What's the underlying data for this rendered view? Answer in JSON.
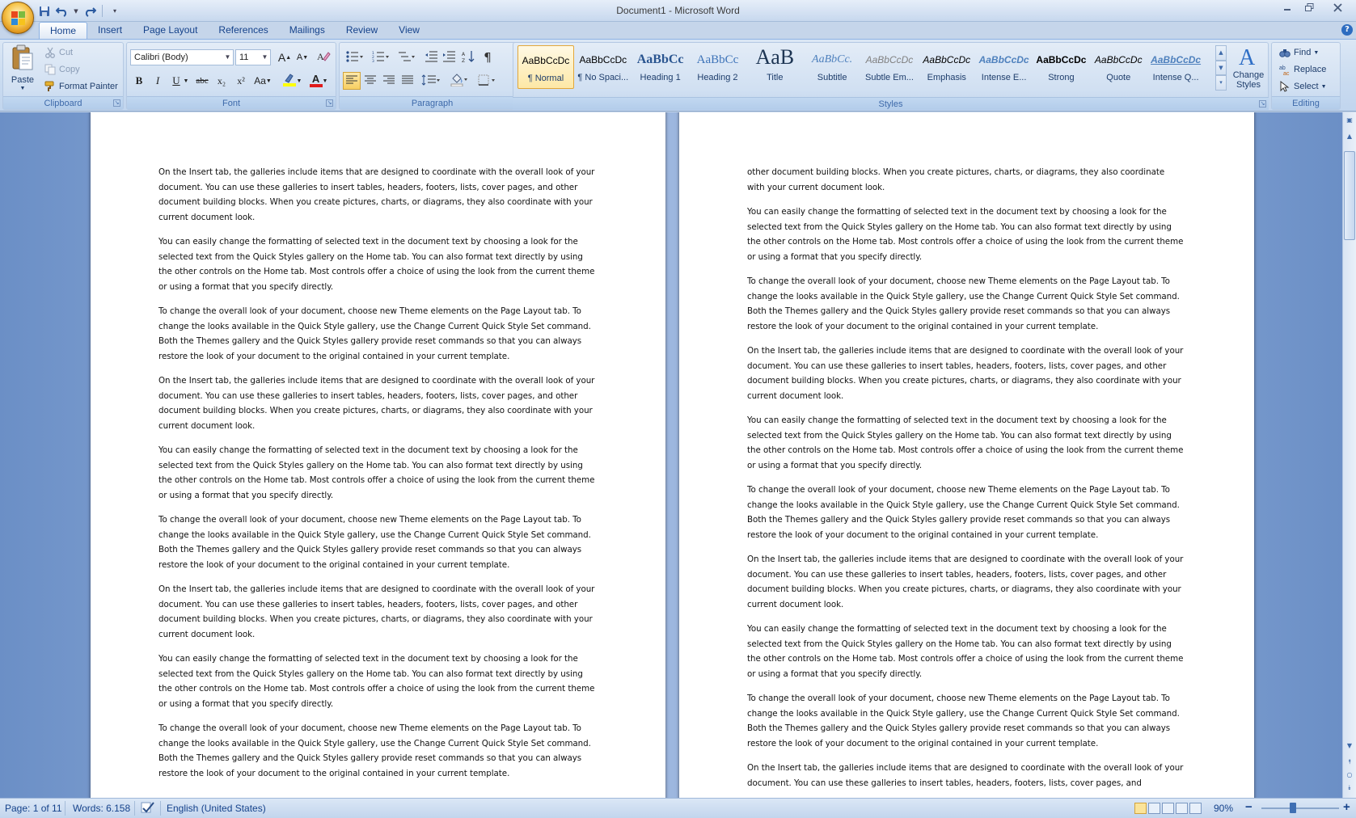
{
  "window": {
    "title": "Document1 - Microsoft Word",
    "controls": [
      "minimize",
      "restore",
      "close"
    ]
  },
  "quick_access": {
    "items": [
      {
        "name": "save-icon"
      },
      {
        "name": "undo-icon"
      },
      {
        "name": "redo-icon"
      },
      {
        "name": "customize-qat-icon"
      }
    ]
  },
  "tabs": [
    {
      "label": "Home",
      "active": true
    },
    {
      "label": "Insert"
    },
    {
      "label": "Page Layout"
    },
    {
      "label": "References"
    },
    {
      "label": "Mailings"
    },
    {
      "label": "Review"
    },
    {
      "label": "View"
    }
  ],
  "ribbon": {
    "clipboard": {
      "label": "Clipboard",
      "paste": "Paste",
      "cut": "Cut",
      "copy": "Copy",
      "format_painter": "Format Painter"
    },
    "font": {
      "label": "Font",
      "family": "Calibri (Body)",
      "size": "11",
      "grow": "A",
      "shrink": "A",
      "bold": "B",
      "italic": "I",
      "underline": "U",
      "strike": "abc",
      "subscript": "x₂",
      "superscript": "x²",
      "change_case": "Aa",
      "font_color_glyph": "A",
      "highlight_color": "#ffff00",
      "font_color": "#e01b1b"
    },
    "paragraph": {
      "label": "Paragraph"
    },
    "styles": {
      "label": "Styles",
      "items": [
        {
          "sample": "AaBbCcDc",
          "name": "¶ Normal",
          "selected": true
        },
        {
          "sample": "AaBbCcDc",
          "name": "¶ No Spaci..."
        },
        {
          "sample": "AaBbCc",
          "name": "Heading 1"
        },
        {
          "sample": "AaBbCc",
          "name": "Heading 2"
        },
        {
          "sample": "AaB",
          "name": "Title"
        },
        {
          "sample": "AaBbCc.",
          "name": "Subtitle"
        },
        {
          "sample": "AaBbCcDc",
          "name": "Subtle Em..."
        },
        {
          "sample": "AaBbCcDc",
          "name": "Emphasis"
        },
        {
          "sample": "AaBbCcDc",
          "name": "Intense E..."
        },
        {
          "sample": "AaBbCcDc",
          "name": "Strong"
        },
        {
          "sample": "AaBbCcDc",
          "name": "Quote"
        },
        {
          "sample": "AaBbCcDc",
          "name": "Intense Q..."
        }
      ],
      "change_styles_line1": "Change",
      "change_styles_line2": "Styles"
    },
    "editing": {
      "label": "Editing",
      "find": "Find",
      "replace": "Replace",
      "select": "Select"
    }
  },
  "document": {
    "left_page": [
      "On the Insert tab, the galleries include items that are designed to coordinate with the overall look of your document. You can use these galleries to insert tables, headers, footers, lists, cover pages, and other document building blocks. When you create pictures, charts, or diagrams, they also coordinate with your current document look.",
      "You can easily change the formatting of selected text in the document text by choosing a look for the selected text from the Quick Styles gallery on the Home tab. You can also format text directly by using the other controls on the Home tab. Most controls offer a choice of using the look from the current theme or using a format that you specify directly.",
      "To change the overall look of your document, choose new Theme elements on the Page Layout tab. To change the looks available in the Quick Style gallery, use the Change Current Quick Style Set command. Both the Themes gallery and the Quick Styles gallery provide reset commands so that you can always restore the look of your document to the original contained in your current template.",
      "On the Insert tab, the galleries include items that are designed to coordinate with the overall look of your document. You can use these galleries to insert tables, headers, footers, lists, cover pages, and other document building blocks. When you create pictures, charts, or diagrams, they also coordinate with your current document look.",
      "You can easily change the formatting of selected text in the document text by choosing a look for the selected text from the Quick Styles gallery on the Home tab. You can also format text directly by using the other controls on the Home tab. Most controls offer a choice of using the look from the current theme or using a format that you specify directly.",
      "To change the overall look of your document, choose new Theme elements on the Page Layout tab. To change the looks available in the Quick Style gallery, use the Change Current Quick Style Set command. Both the Themes gallery and the Quick Styles gallery provide reset commands so that you can always restore the look of your document to the original contained in your current template.",
      "On the Insert tab, the galleries include items that are designed to coordinate with the overall look of your document. You can use these galleries to insert tables, headers, footers, lists, cover pages, and other document building blocks. When you create pictures, charts, or diagrams, they also coordinate with your current document look.",
      "You can easily change the formatting of selected text in the document text by choosing a look for the selected text from the Quick Styles gallery on the Home tab. You can also format text directly by using the other controls on the Home tab. Most controls offer a choice of using the look from the current theme or using a format that you specify directly.",
      "To change the overall look of your document, choose new Theme elements on the Page Layout tab. To change the looks available in the Quick Style gallery, use the Change Current Quick Style Set command. Both the Themes gallery and the Quick Styles gallery provide reset commands so that you can always restore the look of your document to the original contained in your current template."
    ],
    "right_page": [
      "other document building blocks. When you create pictures, charts, or diagrams, they also coordinate with your current document look.",
      "You can easily change the formatting of selected text in the document text by choosing a look for the selected text from the Quick Styles gallery on the Home tab. You can also format text directly by using the other controls on the Home tab. Most controls offer a choice of using the look from the current theme or using a format that you specify directly.",
      "To change the overall look of your document, choose new Theme elements on the Page Layout tab. To change the looks available in the Quick Style gallery, use the Change Current Quick Style Set command. Both the Themes gallery and the Quick Styles gallery provide reset commands so that you can always restore the look of your document to the original contained in your current template.",
      "On the Insert tab, the galleries include items that are designed to coordinate with the overall look of your document. You can use these galleries to insert tables, headers, footers, lists, cover pages, and other document building blocks. When you create pictures, charts, or diagrams, they also coordinate with your current document look.",
      "You can easily change the formatting of selected text in the document text by choosing a look for the selected text from the Quick Styles gallery on the Home tab. You can also format text directly by using the other controls on the Home tab. Most controls offer a choice of using the look from the current theme or using a format that you specify directly.",
      "To change the overall look of your document, choose new Theme elements on the Page Layout tab. To change the looks available in the Quick Style gallery, use the Change Current Quick Style Set command. Both the Themes gallery and the Quick Styles gallery provide reset commands so that you can always restore the look of your document to the original contained in your current template.",
      "On the Insert tab, the galleries include items that are designed to coordinate with the overall look of your document. You can use these galleries to insert tables, headers, footers, lists, cover pages, and other document building blocks. When you create pictures, charts, or diagrams, they also coordinate with your current document look.",
      "You can easily change the formatting of selected text in the document text by choosing a look for the selected text from the Quick Styles gallery on the Home tab. You can also format text directly by using the other controls on the Home tab. Most controls offer a choice of using the look from the current theme or using a format that you specify directly.",
      "To change the overall look of your document, choose new Theme elements on the Page Layout tab. To change the looks available in the Quick Style gallery, use the Change Current Quick Style Set command. Both the Themes gallery and the Quick Styles gallery provide reset commands so that you can always restore the look of your document to the original contained in your current template.",
      "On the Insert tab, the galleries include items that are designed to coordinate with the overall look of your document. You can use these galleries to insert tables, headers, footers, lists, cover pages, and"
    ]
  },
  "statusbar": {
    "page": "Page: 1 of 11",
    "words": "Words: 6.158",
    "language": "English (United States)",
    "zoom": "90%",
    "zoom_out": "−",
    "zoom_in": "+"
  },
  "colors": {
    "accent": "#15428b",
    "ribbon_bg": "#c9dbf0",
    "selected_style": "#fde8a6"
  }
}
